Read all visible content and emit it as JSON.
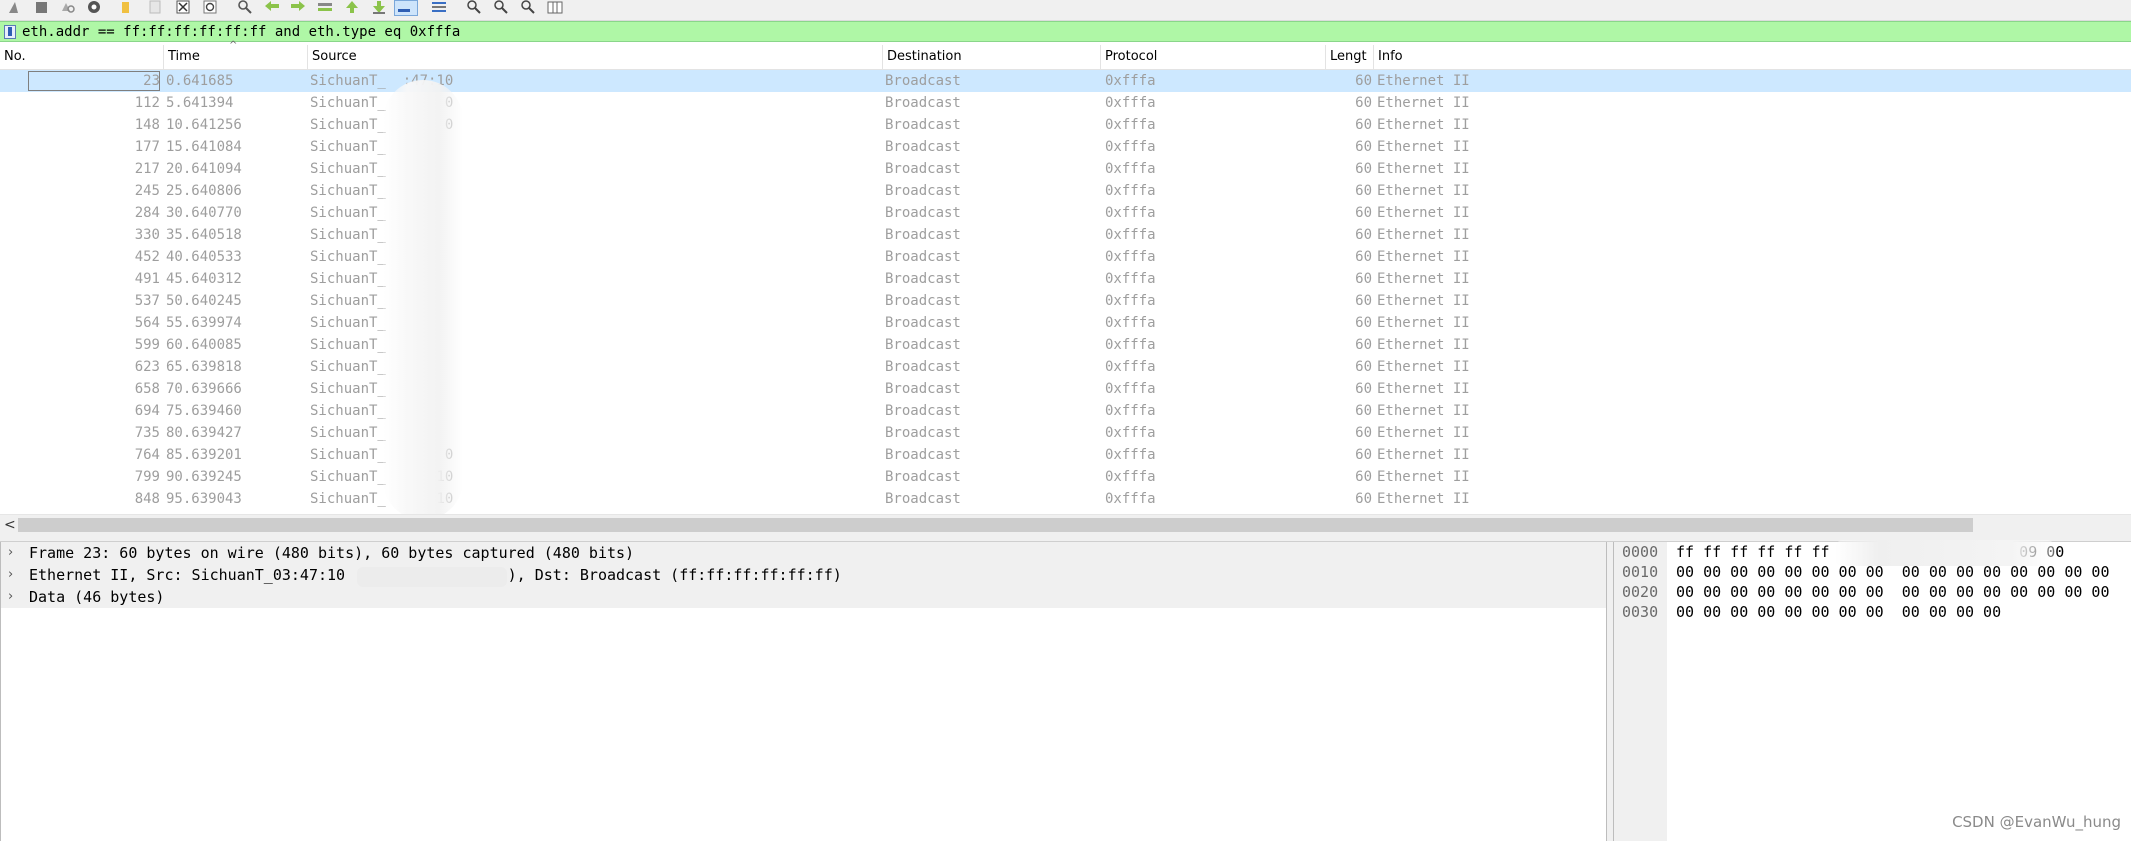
{
  "toolbar": {
    "icons": [
      "shark-fin-icon",
      "stop-icon",
      "restart-icon",
      "options-gear-icon",
      "open-folder-icon",
      "save-file-icon",
      "close-file-icon",
      "reload-icon",
      "find-packet-icon",
      "go-back-icon",
      "go-forward-icon",
      "go-to-packet-icon",
      "go-first-icon",
      "go-last-icon",
      "autoscroll-icon",
      "colorize-icon",
      "zoom-in-icon",
      "zoom-out-icon",
      "zoom-normal-icon",
      "resize-columns-icon"
    ]
  },
  "filter": {
    "text": "eth.addr == ff:ff:ff:ff:ff:ff and eth.type eq 0xfffa",
    "background": "#aff7a6"
  },
  "columns": {
    "no": "No.",
    "time": "Time",
    "source": "Source",
    "destination": "Destination",
    "protocol": "Protocol",
    "length": "Lengt",
    "info": "Info",
    "sort_indicator": "^"
  },
  "packets": [
    {
      "no": "23",
      "time": "0.641685",
      "source": "SichuanT_  :47:10",
      "destination": "Broadcast",
      "protocol": "0xfffa",
      "length": "60",
      "info": "Ethernet II"
    },
    {
      "no": "112",
      "time": "5.641394",
      "source": "SichuanT_       0",
      "destination": "Broadcast",
      "protocol": "0xfffa",
      "length": "60",
      "info": "Ethernet II"
    },
    {
      "no": "148",
      "time": "10.641256",
      "source": "SichuanT_       0",
      "destination": "Broadcast",
      "protocol": "0xfffa",
      "length": "60",
      "info": "Ethernet II"
    },
    {
      "no": "177",
      "time": "15.641084",
      "source": "SichuanT_",
      "destination": "Broadcast",
      "protocol": "0xfffa",
      "length": "60",
      "info": "Ethernet II"
    },
    {
      "no": "217",
      "time": "20.641094",
      "source": "SichuanT_",
      "destination": "Broadcast",
      "protocol": "0xfffa",
      "length": "60",
      "info": "Ethernet II"
    },
    {
      "no": "245",
      "time": "25.640806",
      "source": "SichuanT_",
      "destination": "Broadcast",
      "protocol": "0xfffa",
      "length": "60",
      "info": "Ethernet II"
    },
    {
      "no": "284",
      "time": "30.640770",
      "source": "SichuanT_",
      "destination": "Broadcast",
      "protocol": "0xfffa",
      "length": "60",
      "info": "Ethernet II"
    },
    {
      "no": "330",
      "time": "35.640518",
      "source": "SichuanT_",
      "destination": "Broadcast",
      "protocol": "0xfffa",
      "length": "60",
      "info": "Ethernet II"
    },
    {
      "no": "452",
      "time": "40.640533",
      "source": "SichuanT_",
      "destination": "Broadcast",
      "protocol": "0xfffa",
      "length": "60",
      "info": "Ethernet II"
    },
    {
      "no": "491",
      "time": "45.640312",
      "source": "SichuanT_",
      "destination": "Broadcast",
      "protocol": "0xfffa",
      "length": "60",
      "info": "Ethernet II"
    },
    {
      "no": "537",
      "time": "50.640245",
      "source": "SichuanT_",
      "destination": "Broadcast",
      "protocol": "0xfffa",
      "length": "60",
      "info": "Ethernet II"
    },
    {
      "no": "564",
      "time": "55.639974",
      "source": "SichuanT_",
      "destination": "Broadcast",
      "protocol": "0xfffa",
      "length": "60",
      "info": "Ethernet II"
    },
    {
      "no": "599",
      "time": "60.640085",
      "source": "SichuanT_",
      "destination": "Broadcast",
      "protocol": "0xfffa",
      "length": "60",
      "info": "Ethernet II"
    },
    {
      "no": "623",
      "time": "65.639818",
      "source": "SichuanT_",
      "destination": "Broadcast",
      "protocol": "0xfffa",
      "length": "60",
      "info": "Ethernet II"
    },
    {
      "no": "658",
      "time": "70.639666",
      "source": "SichuanT_",
      "destination": "Broadcast",
      "protocol": "0xfffa",
      "length": "60",
      "info": "Ethernet II"
    },
    {
      "no": "694",
      "time": "75.639460",
      "source": "SichuanT_",
      "destination": "Broadcast",
      "protocol": "0xfffa",
      "length": "60",
      "info": "Ethernet II"
    },
    {
      "no": "735",
      "time": "80.639427",
      "source": "SichuanT_",
      "destination": "Broadcast",
      "protocol": "0xfffa",
      "length": "60",
      "info": "Ethernet II"
    },
    {
      "no": "764",
      "time": "85.639201",
      "source": "SichuanT_       0",
      "destination": "Broadcast",
      "protocol": "0xfffa",
      "length": "60",
      "info": "Ethernet II"
    },
    {
      "no": "799",
      "time": "90.639245",
      "source": "SichuanT_      10",
      "destination": "Broadcast",
      "protocol": "0xfffa",
      "length": "60",
      "info": "Ethernet II"
    },
    {
      "no": "848",
      "time": "95.639043",
      "source": "SichuanT_      10",
      "destination": "Broadcast",
      "protocol": "0xfffa",
      "length": "60",
      "info": "Ethernet II"
    }
  ],
  "details": [
    "Frame 23: 60 bytes on wire (480 bits), 60 bytes captured (480 bits)",
    "Ethernet II, Src: SichuanT_03:47:10 (               9), Dst: Broadcast (ff:ff:ff:ff:ff:ff)",
    "Data (46 bytes)"
  ],
  "bytes": [
    {
      "offset": "0000",
      "hex": "ff ff ff ff ff ff                     09 00"
    },
    {
      "offset": "0010",
      "hex": "00 00 00 00 00 00 00 00  00 00 00 00 00 00 00 00"
    },
    {
      "offset": "0020",
      "hex": "00 00 00 00 00 00 00 00  00 00 00 00 00 00 00 00"
    },
    {
      "offset": "0030",
      "hex": "00 00 00 00 00 00 00 00  00 00 00 00"
    }
  ],
  "watermark": "CSDN @EvanWu_hung"
}
